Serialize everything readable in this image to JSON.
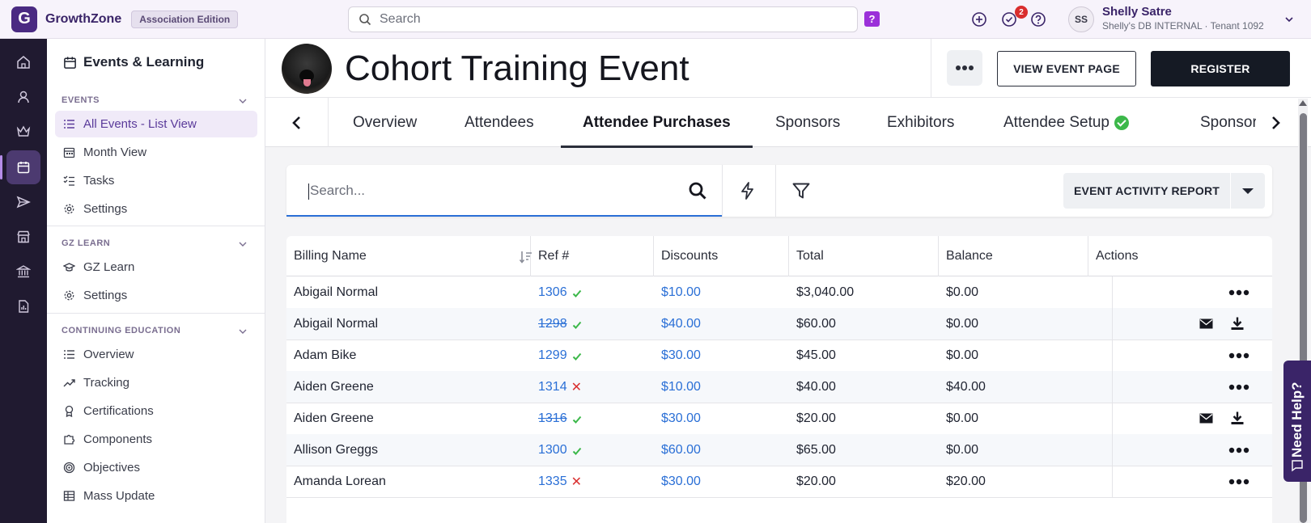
{
  "topbar": {
    "brand": "GrowthZone",
    "edition": "Association Edition",
    "search_placeholder": "Search",
    "help_badge": "?",
    "notification_count": "2",
    "avatar_initials": "SS",
    "user_name": "Shelly Satre",
    "user_sub": "Shelly's DB INTERNAL · Tenant 1092"
  },
  "sidebar": {
    "title": "Events & Learning",
    "sections": [
      {
        "heading": "EVENTS",
        "items": [
          "All Events - List View",
          "Month View",
          "Tasks",
          "Settings"
        ]
      },
      {
        "heading": "GZ LEARN",
        "items": [
          "GZ Learn",
          "Settings"
        ]
      },
      {
        "heading": "CONTINUING EDUCATION",
        "items": [
          "Overview",
          "Tracking",
          "Certifications",
          "Components",
          "Objectives",
          "Mass Update"
        ]
      }
    ]
  },
  "header": {
    "title": "Cohort Training Event",
    "view_event_label": "VIEW EVENT PAGE",
    "register_label": "REGISTER"
  },
  "tabs": [
    "Overview",
    "Attendees",
    "Attendee Purchases",
    "Sponsors",
    "Exhibitors",
    "Attendee Setup",
    "Sponsor"
  ],
  "toolbar": {
    "search_placeholder": "Search...",
    "report_label": "EVENT ACTIVITY REPORT"
  },
  "table": {
    "columns": [
      "Billing Name",
      "Ref #",
      "Discounts",
      "Total",
      "Balance",
      "Actions"
    ],
    "rows": [
      {
        "name": "Abigail Normal",
        "ref": "1306",
        "status": "ok",
        "void": false,
        "discount": "$10.00",
        "total": "$3,040.00",
        "balance": "$0.00",
        "actions": "more"
      },
      {
        "name": "Abigail Normal",
        "ref": "1298",
        "status": "ok",
        "void": true,
        "discount": "$40.00",
        "total": "$60.00",
        "balance": "$0.00",
        "actions": "mail-download"
      },
      {
        "name": "Adam Bike",
        "ref": "1299",
        "status": "ok",
        "void": false,
        "discount": "$30.00",
        "total": "$45.00",
        "balance": "$0.00",
        "actions": "more"
      },
      {
        "name": "Aiden Greene",
        "ref": "1314",
        "status": "fail",
        "void": false,
        "discount": "$10.00",
        "total": "$40.00",
        "balance": "$40.00",
        "actions": "more"
      },
      {
        "name": "Aiden Greene",
        "ref": "1316",
        "status": "ok",
        "void": true,
        "discount": "$30.00",
        "total": "$20.00",
        "balance": "$0.00",
        "actions": "mail-download"
      },
      {
        "name": "Allison Greggs",
        "ref": "1300",
        "status": "ok",
        "void": false,
        "discount": "$60.00",
        "total": "$65.00",
        "balance": "$0.00",
        "actions": "more"
      },
      {
        "name": "Amanda Lorean",
        "ref": "1335",
        "status": "fail",
        "void": false,
        "discount": "$30.00",
        "total": "$20.00",
        "balance": "$20.00",
        "actions": "more"
      }
    ]
  },
  "need_help": "Need Help?"
}
